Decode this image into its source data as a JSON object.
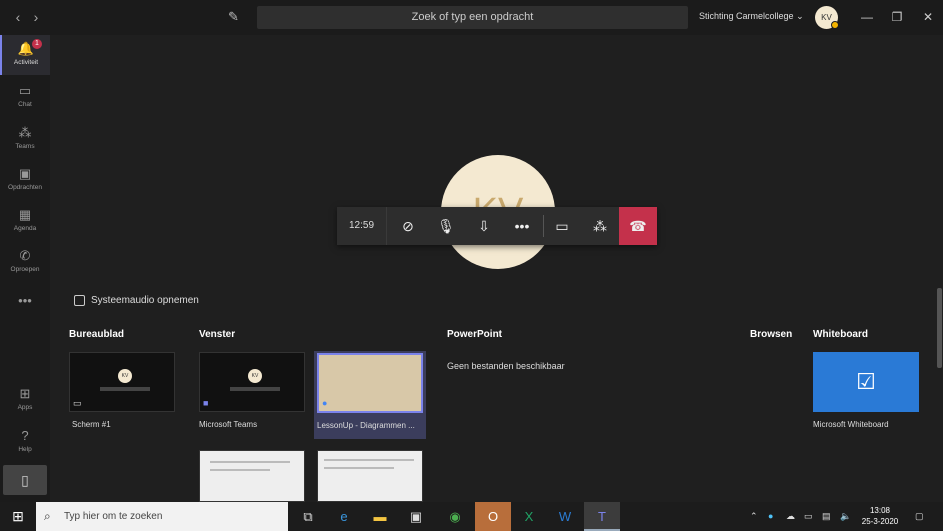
{
  "titlebar": {
    "back_icon": "chevron-left-icon",
    "forward_icon": "chevron-right-icon",
    "compose_icon": "compose-icon",
    "search_placeholder": "Zoek of typ een opdracht",
    "org_name": "Stichting Carmelcollege",
    "user_initials": "KV",
    "window_controls": [
      "minimize-icon",
      "restore-icon",
      "close-icon"
    ]
  },
  "rail": {
    "items": [
      {
        "label": "Activiteit",
        "icon": "bell-icon",
        "badge": "1"
      },
      {
        "label": "Chat",
        "icon": "chat-icon"
      },
      {
        "label": "Teams",
        "icon": "teams-icon"
      },
      {
        "label": "Opdrachten",
        "icon": "assignments-icon"
      },
      {
        "label": "Agenda",
        "icon": "calendar-icon"
      },
      {
        "label": "Oproepen",
        "icon": "phone-icon"
      },
      {
        "label": "",
        "icon": "more-icon"
      }
    ],
    "bottom": [
      {
        "label": "Apps",
        "icon": "apps-icon"
      },
      {
        "label": "Help",
        "icon": "help-icon"
      }
    ]
  },
  "call": {
    "avatar_initials": "KV",
    "timer": "12:59",
    "controls": [
      "camera-off-icon",
      "microphone-icon",
      "share-tray-icon",
      "more-icon",
      "chat-icon",
      "participants-icon",
      "hang-up-icon"
    ]
  },
  "share": {
    "system_audio_label": "Systeemaudio opnemen",
    "sections": {
      "desktop": "Bureaublad",
      "window": "Venster",
      "powerpoint": "PowerPoint",
      "browse": "Browsen",
      "whiteboard": "Whiteboard"
    },
    "desktop_items": [
      {
        "caption": "Scherm #1"
      }
    ],
    "window_items": [
      {
        "caption": "Microsoft Teams"
      },
      {
        "caption": "LessonUp - Diagrammen ..."
      }
    ],
    "powerpoint_empty": "Geen bestanden beschikbaar",
    "whiteboard_items": [
      {
        "caption": "Microsoft Whiteboard"
      }
    ]
  },
  "taskbar": {
    "search_placeholder": "Typ hier om te zoeken",
    "apps": [
      "task-view-icon",
      "edge-icon",
      "file-explorer-icon",
      "store-icon",
      "chrome-icon",
      "outlook-icon",
      "excel-icon",
      "word-icon",
      "teams-icon"
    ],
    "time": "13:08",
    "date": "25-3-2020"
  },
  "colors": {
    "accent": "#7b83eb",
    "hangup": "#c4314b",
    "whiteboard": "#2a7ad6"
  }
}
